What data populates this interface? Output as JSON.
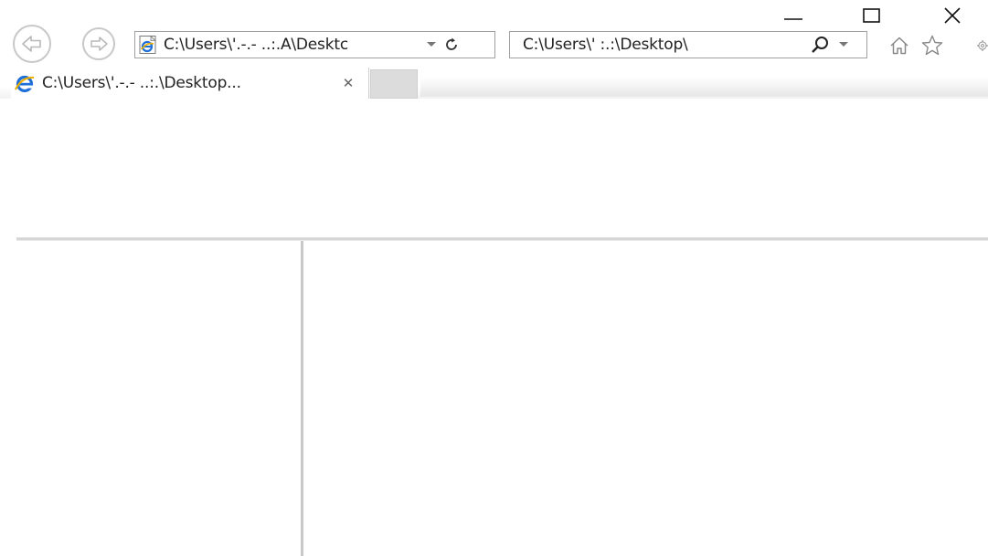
{
  "window": {
    "controls": {
      "minimize_icon": "minimize-icon",
      "maximize_icon": "maximize-icon",
      "close_icon": "close-icon"
    }
  },
  "navigation": {
    "back_icon": "back-arrow-icon",
    "forward_icon": "forward-arrow-icon"
  },
  "address_bar": {
    "value": "C:\\Users\\'.-.- ..:.A\\Desktc",
    "page_icon": "ie-page-icon",
    "dropdown_icon": "chevron-down-icon",
    "refresh_icon": "refresh-icon"
  },
  "search_box": {
    "value": "C:\\Users\\'          :.:\\Desktop\\",
    "search_icon": "search-icon",
    "dropdown_icon": "chevron-down-icon"
  },
  "toolbar": {
    "home_icon": "home-icon",
    "favorites_icon": "star-icon",
    "settings_icon": "gear-icon"
  },
  "tabs": [
    {
      "title": "C:\\Users\\'.-.- ..:.\\Desktop...",
      "icon": "ie-logo-icon",
      "close_label": "✕",
      "active": true
    }
  ],
  "colors": {
    "border": "#a0a0a0",
    "frame_divider": "#c8c8c8",
    "ie_blue": "#1e6fd8",
    "ie_gold": "#f0b000"
  }
}
